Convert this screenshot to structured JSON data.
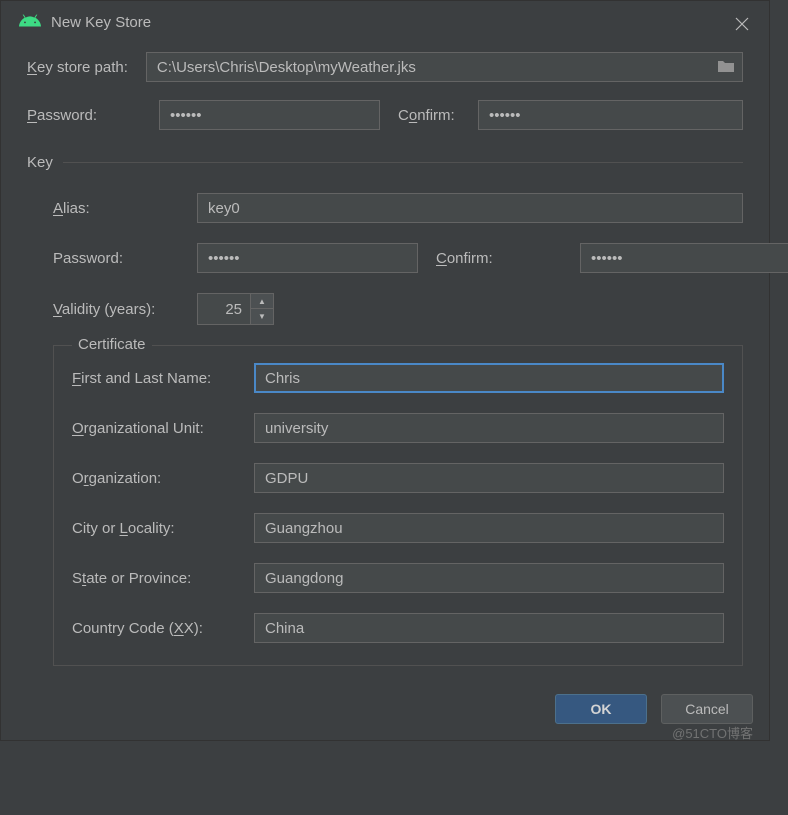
{
  "dialog": {
    "title": "New Key Store",
    "keyStorePathLabel": "Key store path:",
    "keyStorePathValue": "C:\\Users\\Chris\\Desktop\\myWeather.jks",
    "passwordLabel": "Password:",
    "passwordValue": "••••••",
    "confirmLabel": "Confirm:",
    "confirmValue": "••••••"
  },
  "key": {
    "sectionLabel": "Key",
    "aliasLabel": "Alias:",
    "aliasValue": "key0",
    "passwordLabel": "Password:",
    "passwordValue": "••••••",
    "confirmLabel": "Confirm:",
    "confirmValue": "••••••",
    "validityLabel": "Validity (years):",
    "validityValue": "25"
  },
  "certificate": {
    "legend": "Certificate",
    "firstLastNameLabel": "First and Last Name:",
    "firstLastNameValue": "Chris",
    "orgUnitLabel": "Organizational Unit:",
    "orgUnitValue": "university",
    "orgLabel": "Organization:",
    "orgValue": "GDPU",
    "cityLabel": "City or Locality:",
    "cityValue": "Guangzhou",
    "stateLabel": "State or Province:",
    "stateValue": "Guangdong",
    "countryLabel": "Country Code (XX):",
    "countryValue": "China"
  },
  "buttons": {
    "ok": "OK",
    "cancel": "Cancel"
  },
  "watermark": "@51CTO博客"
}
